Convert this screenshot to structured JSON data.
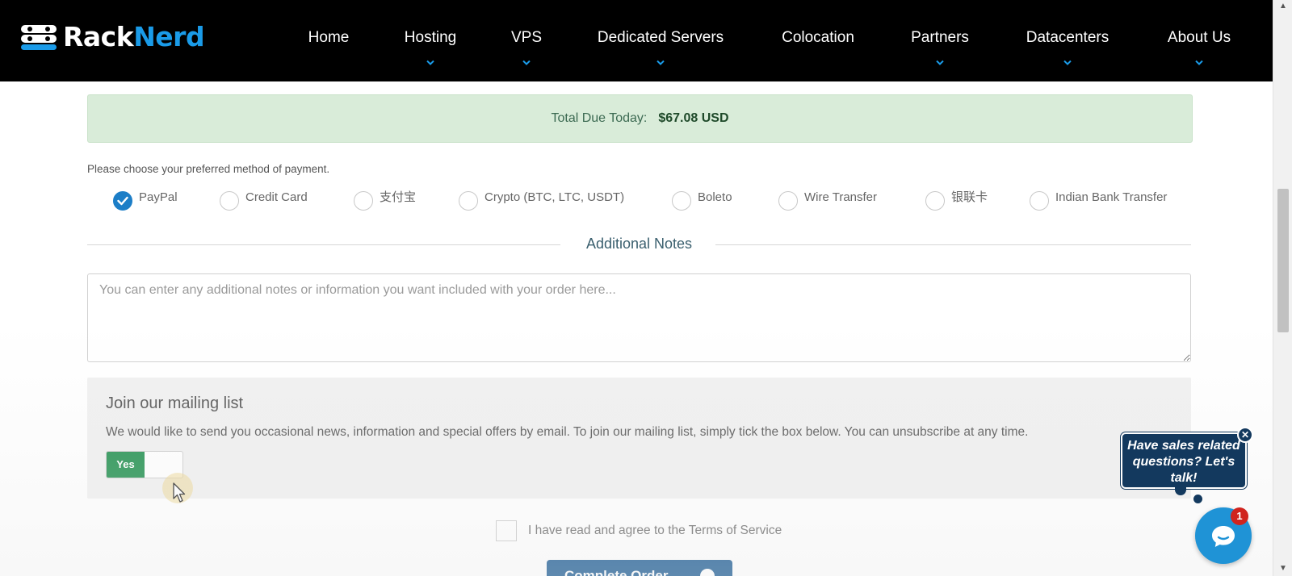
{
  "brand": {
    "logo_part1": "Rack",
    "logo_part2": "Nerd",
    "brand_blue": "#1a9be8"
  },
  "nav": {
    "items": [
      {
        "label": "Home",
        "has_dropdown": false
      },
      {
        "label": "Hosting",
        "has_dropdown": true
      },
      {
        "label": "VPS",
        "has_dropdown": true
      },
      {
        "label": "Dedicated Servers",
        "has_dropdown": true
      },
      {
        "label": "Colocation",
        "has_dropdown": false
      },
      {
        "label": "Partners",
        "has_dropdown": true
      },
      {
        "label": "Datacenters",
        "has_dropdown": true
      },
      {
        "label": "About Us",
        "has_dropdown": true
      }
    ]
  },
  "order": {
    "total_label": "Total Due Today:",
    "total_amount": "$67.08 USD",
    "payment_instruction": "Please choose your preferred method of payment.",
    "payment_methods": [
      {
        "label": "PayPal",
        "selected": true
      },
      {
        "label": "Credit Card",
        "selected": false
      },
      {
        "label": "支付宝",
        "selected": false
      },
      {
        "label": "Crypto (BTC, LTC, USDT)",
        "selected": false
      },
      {
        "label": "Boleto",
        "selected": false
      },
      {
        "label": "Wire Transfer",
        "selected": false
      },
      {
        "label": "银联卡",
        "selected": false
      },
      {
        "label": "Indian Bank Transfer",
        "selected": false
      }
    ],
    "notes_heading": "Additional Notes",
    "notes_placeholder": "You can enter any additional notes or information you want included with your order here...",
    "notes_value": ""
  },
  "mailing": {
    "title": "Join our mailing list",
    "description": "We would like to send you occasional news, information and special offers by email. To join our mailing list, simply tick the box below. You can unsubscribe at any time.",
    "toggle_label": "Yes",
    "toggle_on": true
  },
  "tos": {
    "label": "I have read and agree to the Terms of Service",
    "checked": false
  },
  "checkout": {
    "button_label": "Complete Order"
  },
  "chat": {
    "prompt": "Have sales related questions? Let's talk!",
    "unread_count": "1",
    "close_glyph": "✕"
  },
  "colors": {
    "success_bg": "#d9ecd9",
    "radio_checked": "#1c7ec7",
    "toggle_on": "#1f8f4d",
    "chat_navy": "#13395e",
    "chat_blue": "#1f93d6",
    "badge_red": "#d0241e"
  }
}
